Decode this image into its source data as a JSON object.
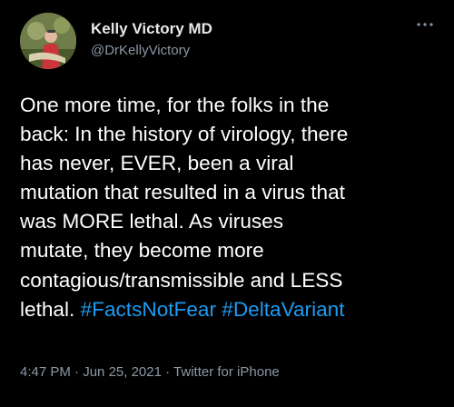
{
  "tweet": {
    "author_name": "Kelly Victory MD",
    "author_handle": "@DrKellyVictory",
    "body_lines": [
      "One more time, for the folks in the",
      "back: In the history of virology, there",
      "has never, EVER, been a viral",
      "mutation that resulted in a virus that",
      "was MORE lethal. As viruses",
      "mutate, they become more",
      "contagious/transmissible and LESS",
      "lethal."
    ],
    "hashtags": [
      "#FactsNotFear",
      "#DeltaVariant"
    ],
    "time": "4:47 PM",
    "date": "Jun 25, 2021",
    "source": "Twitter for iPhone",
    "separator": "·"
  },
  "icons": {
    "more": "more-options-icon",
    "avatar": "avatar"
  },
  "colors": {
    "background": "#000000",
    "text": "#ffffff",
    "secondary": "#8b98a5",
    "hashtag": "#1d9bf0"
  }
}
